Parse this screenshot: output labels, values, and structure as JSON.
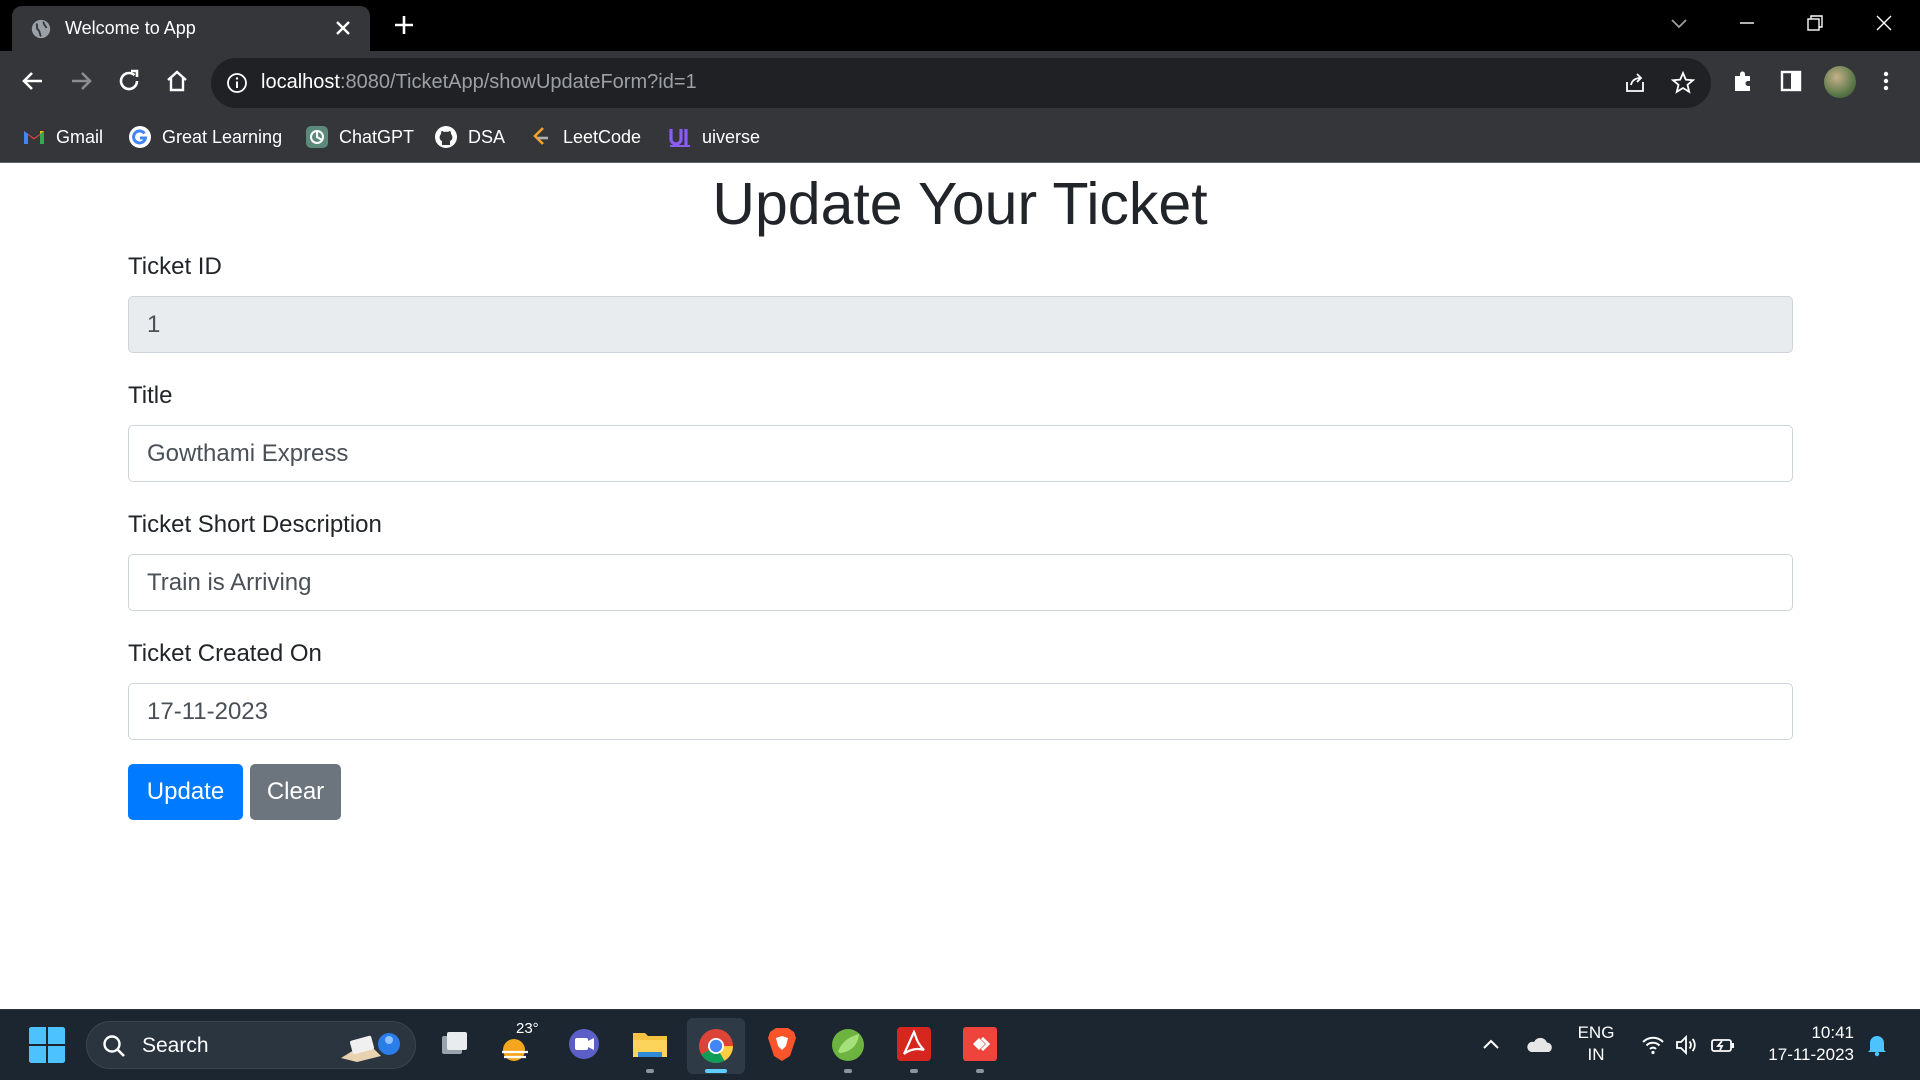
{
  "browser": {
    "tab_title": "Welcome to App",
    "url_host": "localhost",
    "url_rest": ":8080/TicketApp/showUpdateForm?id=1",
    "bookmarks": [
      {
        "label": "Gmail",
        "icon": "gmail-icon"
      },
      {
        "label": "Great Learning",
        "icon": "great-learning-icon"
      },
      {
        "label": "ChatGPT",
        "icon": "chatgpt-icon"
      },
      {
        "label": "DSA",
        "icon": "github-icon"
      },
      {
        "label": "LeetCode",
        "icon": "leetcode-icon"
      },
      {
        "label": "uiverse",
        "icon": "uiverse-icon"
      }
    ]
  },
  "form": {
    "title": "Update Your Ticket",
    "fields": [
      {
        "label": "Ticket ID",
        "value": "1",
        "readonly": true
      },
      {
        "label": "Title",
        "value": "Gowthami Express"
      },
      {
        "label": "Ticket Short Description",
        "value": "Train is Arriving"
      },
      {
        "label": "Ticket Created On",
        "value": "17-11-2023"
      }
    ],
    "update_label": "Update",
    "clear_label": "Clear"
  },
  "taskbar": {
    "search_label": "Search",
    "weather_temp": "23°",
    "lang_line1": "ENG",
    "lang_line2": "IN",
    "time": "10:41",
    "date": "17-11-2023"
  },
  "colors": {
    "primary": "#007bff",
    "secondary": "#6c757d",
    "readonly_bg": "#e9ecef",
    "chrome_dark": "#35363a"
  }
}
